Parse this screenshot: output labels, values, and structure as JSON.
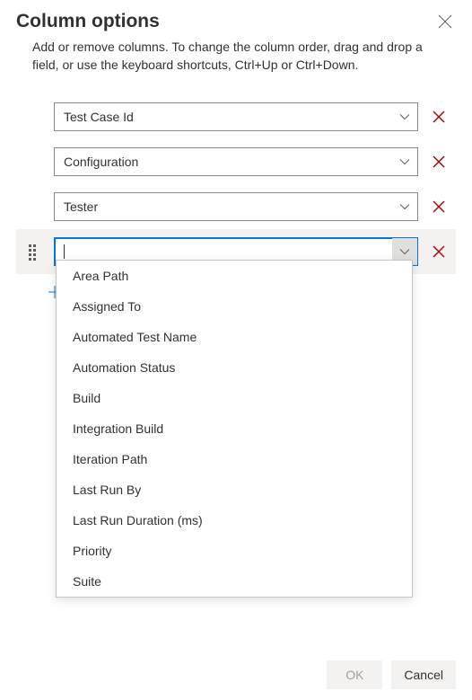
{
  "title": "Column options",
  "subtitle": "Add or remove columns. To change the column order, drag and drop a field, or use the keyboard shortcuts, Ctrl+Up or Ctrl+Down.",
  "columns": [
    {
      "label": "Test Case Id"
    },
    {
      "label": "Configuration"
    },
    {
      "label": "Tester"
    }
  ],
  "activeInputValue": "",
  "dropdown": {
    "items": [
      "Area Path",
      "Assigned To",
      "Automated Test Name",
      "Automation Status",
      "Build",
      "Integration Build",
      "Iteration Path",
      "Last Run By",
      "Last Run Duration (ms)",
      "Priority",
      "Suite"
    ]
  },
  "buttons": {
    "ok": "OK",
    "cancel": "Cancel"
  }
}
